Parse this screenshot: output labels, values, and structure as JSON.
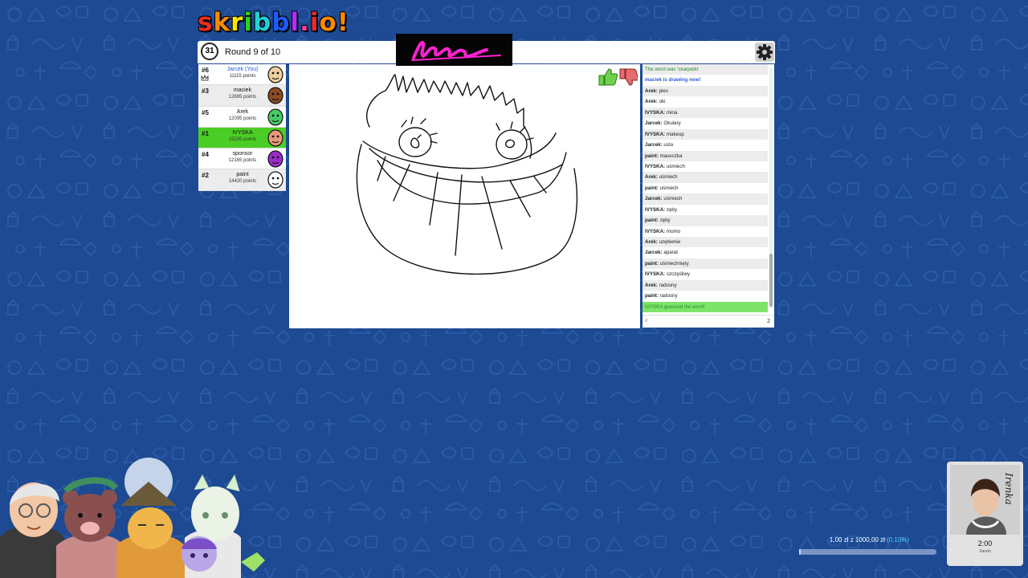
{
  "game": {
    "logo_letters": [
      "s",
      "k",
      "r",
      "i",
      "b",
      "b",
      "l",
      ".",
      "i",
      "o",
      "!"
    ],
    "logo_colors": [
      "#ef2b1f",
      "#ff8a00",
      "#ffe500",
      "#2bd31f",
      "#1fd0d6",
      "#1f5bff",
      "#b32cff",
      "#ff3fa8",
      "#ef2b1f",
      "#ff8a00",
      "#ff8a00"
    ],
    "timer": "31",
    "round_label": "Round 9 of 10"
  },
  "players": [
    {
      "rank": "#6",
      "name": "Jarcek (You)",
      "points": "11115 points",
      "you": true,
      "highlight": false,
      "color": "#f0d0a0"
    },
    {
      "rank": "#3",
      "name": "maciek",
      "points": "12695 points",
      "you": false,
      "highlight": false,
      "color": "#8b4a22"
    },
    {
      "rank": "#5",
      "name": "Arek",
      "points": "12095 points",
      "you": false,
      "highlight": false,
      "color": "#44cc66"
    },
    {
      "rank": "#1",
      "name": "IVYSKA",
      "points": "15235 points",
      "you": false,
      "highlight": true,
      "color": "#e89a7a"
    },
    {
      "rank": "#4",
      "name": "sponsor",
      "points": "12165 points",
      "you": false,
      "highlight": false,
      "color": "#9b2cc8"
    },
    {
      "rank": "#2",
      "name": "paint",
      "points": "14420 points",
      "you": false,
      "highlight": false,
      "color": "#ffffff"
    }
  ],
  "chat": [
    {
      "kind": "sys",
      "text": "The word was 'skarpetki'"
    },
    {
      "kind": "blue",
      "text": "maciek is drawing now!"
    },
    {
      "kind": "msg",
      "user": "Arek:",
      "text": "pies"
    },
    {
      "kind": "msg",
      "user": "Arek:",
      "text": "oki"
    },
    {
      "kind": "msg",
      "user": "IVYSKA:",
      "text": "mina"
    },
    {
      "kind": "msg",
      "user": "Jarcek:",
      "text": "Okulary"
    },
    {
      "kind": "msg",
      "user": "IVYSKA:",
      "text": "makeup"
    },
    {
      "kind": "msg",
      "user": "Jarcek:",
      "text": "usta"
    },
    {
      "kind": "msg",
      "user": "paint:",
      "text": "maseczka"
    },
    {
      "kind": "msg",
      "user": "IVYSKA:",
      "text": "uśmiech"
    },
    {
      "kind": "msg",
      "user": "Arek:",
      "text": "uśmiech"
    },
    {
      "kind": "msg",
      "user": "paint:",
      "text": "uśmiech"
    },
    {
      "kind": "msg",
      "user": "Jarcek:",
      "text": "uśmiech"
    },
    {
      "kind": "msg",
      "user": "IVYSKA:",
      "text": "zęby"
    },
    {
      "kind": "msg",
      "user": "paint:",
      "text": "zęby"
    },
    {
      "kind": "msg",
      "user": "IVYSKA:",
      "text": "momo"
    },
    {
      "kind": "msg",
      "user": "Arek:",
      "text": "uzębienie"
    },
    {
      "kind": "msg",
      "user": "Jarcek:",
      "text": "aparat"
    },
    {
      "kind": "msg",
      "user": "paint:",
      "text": "uśmiechnięty"
    },
    {
      "kind": "msg",
      "user": "IVYSKA:",
      "text": "szczęśliwy"
    },
    {
      "kind": "msg",
      "user": "Arek:",
      "text": "radosny"
    },
    {
      "kind": "msg",
      "user": "paint:",
      "text": "radosny"
    },
    {
      "kind": "green",
      "text": "IVYSKA guessed the word!"
    }
  ],
  "chat_input": {
    "value": "r",
    "count": "2"
  },
  "donation": {
    "text": "1,00 zł z 1000,00 zł",
    "percent_text": "(0.10%)",
    "fraction": 0.001
  },
  "media_card": {
    "title": "Irenka",
    "time": "2:00",
    "artist": "Sanah"
  }
}
